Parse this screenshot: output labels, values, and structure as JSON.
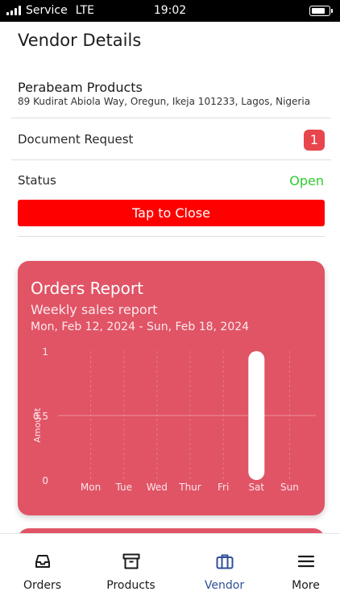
{
  "status_bar": {
    "carrier": "Service",
    "network": "LTE",
    "time": "19:02"
  },
  "page": {
    "title": "Vendor Details"
  },
  "vendor": {
    "name": "Perabeam Products",
    "address": "89 Kudirat Abiola Way, Oregun, Ikeja 101233, Lagos, Nigeria"
  },
  "document_request": {
    "label": "Document Request",
    "count": "1",
    "badge_color": "#e8454c"
  },
  "status": {
    "label": "Status",
    "value": "Open",
    "value_color": "#2ecc2e"
  },
  "close_button": {
    "label": "Tap to Close",
    "color": "#ff0000"
  },
  "orders_report": {
    "title": "Orders Report",
    "subtitle": "Weekly sales report",
    "date_range": "Mon, Feb 12, 2024  -  Sun, Feb 18, 2024",
    "card_color": "#e05466"
  },
  "chart_data": {
    "type": "bar",
    "categories": [
      "Mon",
      "Tue",
      "Wed",
      "Thur",
      "Fri",
      "Sat",
      "Sun"
    ],
    "values": [
      0,
      0,
      0,
      0,
      0,
      1,
      0
    ],
    "ylabel": "Amount",
    "xlabel": "",
    "ylim": [
      0,
      1
    ],
    "yticks": [
      "0",
      "0.5",
      "1"
    ],
    "grid": true,
    "bar_color": "#ffffff"
  },
  "tabs": [
    {
      "label": "Orders",
      "icon": "inbox-icon",
      "active": false
    },
    {
      "label": "Products",
      "icon": "archive-box-icon",
      "active": false
    },
    {
      "label": "Vendor",
      "icon": "briefcase-icon",
      "active": true
    },
    {
      "label": "More",
      "icon": "menu-icon",
      "active": false
    }
  ],
  "colors": {
    "active_tab": "#2f4f9a"
  }
}
